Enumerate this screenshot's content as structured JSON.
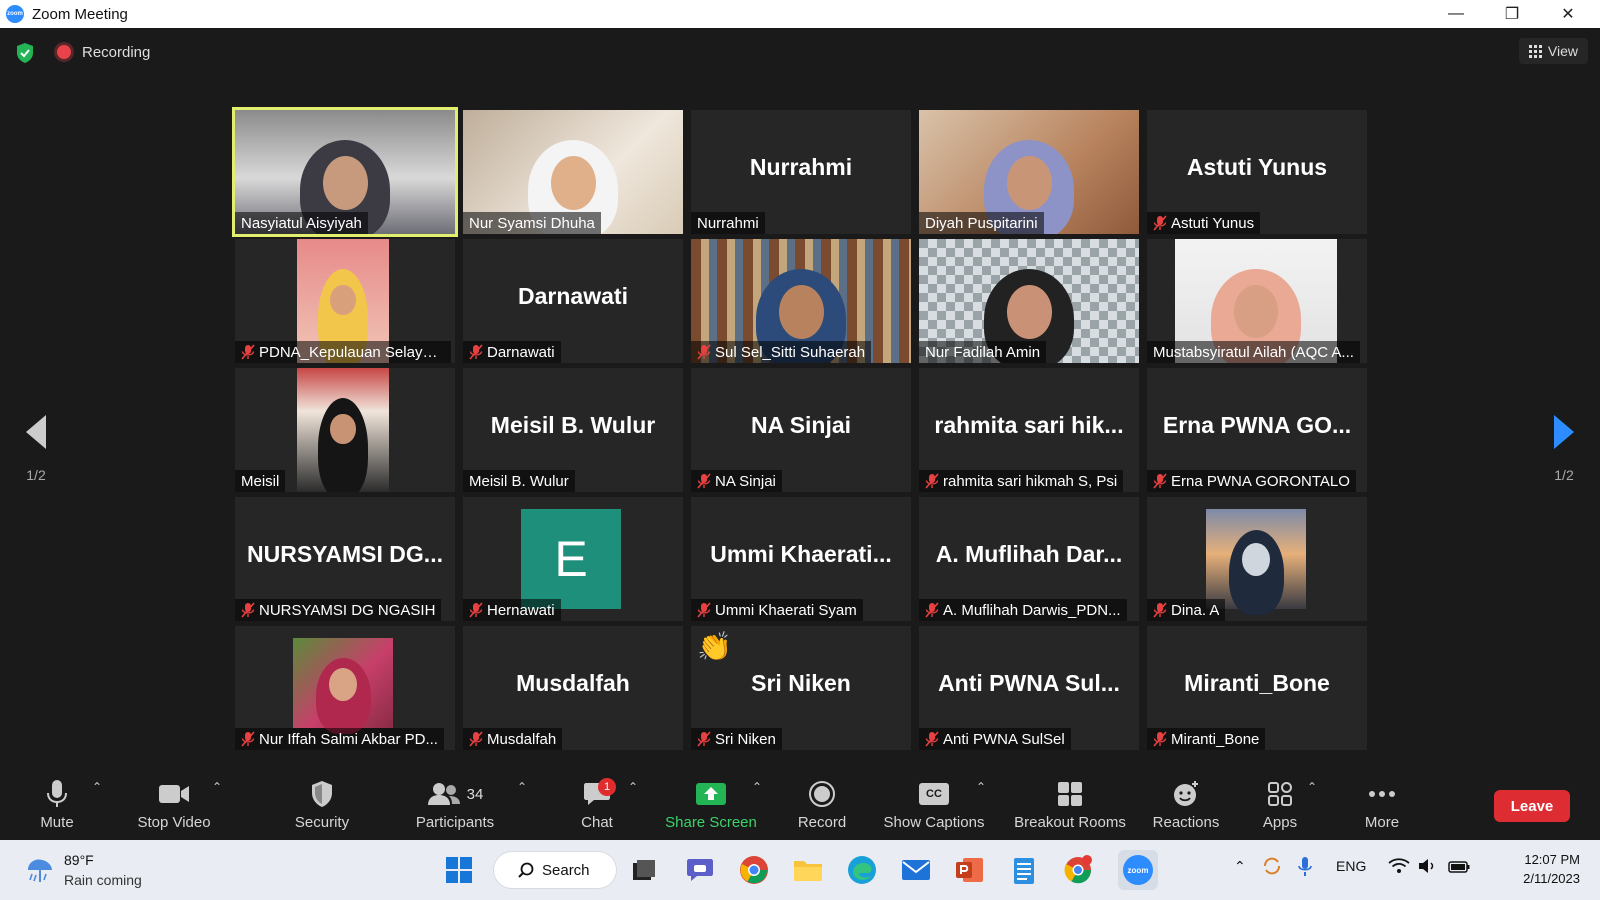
{
  "window": {
    "title": "Zoom Meeting",
    "logo_text": "zoom"
  },
  "topbar": {
    "recording_label": "Recording",
    "view_label": "View"
  },
  "grid": {
    "tiles": [
      {
        "name": "Nasyiatul Aisyiyah",
        "big": "",
        "muted": false,
        "active": true
      },
      {
        "name": "Nur Syamsi Dhuha",
        "big": "",
        "muted": false
      },
      {
        "name": "Nurrahmi",
        "big": "Nurrahmi",
        "muted": false
      },
      {
        "name": "Diyah Puspitarini",
        "big": "",
        "muted": false
      },
      {
        "name": "Astuti Yunus",
        "big": "Astuti Yunus",
        "muted": true
      },
      {
        "name": "PDNA_Kepulauan Selayar...",
        "big": "",
        "muted": true
      },
      {
        "name": "Darnawati",
        "big": "Darnawati",
        "muted": true
      },
      {
        "name": "Sul Sel_Sitti Suhaerah",
        "big": "",
        "muted": true
      },
      {
        "name": "Nur Fadilah Amin",
        "big": "",
        "muted": false
      },
      {
        "name": "Mustabsyiratul Ailah (AQC A...",
        "big": "",
        "muted": false
      },
      {
        "name": "Meisil",
        "big": "",
        "muted": false
      },
      {
        "name": "Meisil B. Wulur",
        "big": "Meisil B. Wulur",
        "muted": false
      },
      {
        "name": "NA Sinjai",
        "big": "NA Sinjai",
        "muted": true
      },
      {
        "name": "rahmita sari hikmah S, Psi",
        "big": "rahmita sari hik...",
        "muted": true
      },
      {
        "name": "Erna PWNA GORONTALO",
        "big": "Erna PWNA GO...",
        "muted": true
      },
      {
        "name": "NURSYAMSI DG NGASIH",
        "big": "NURSYAMSI DG...",
        "muted": true
      },
      {
        "name": "Hernawati",
        "big": "",
        "muted": true,
        "avatar_letter": "E"
      },
      {
        "name": "Ummi Khaerati Syam",
        "big": "Ummi Khaerati...",
        "muted": true
      },
      {
        "name": "A. Muflihah Darwis_PDN...",
        "big": "A. Muflihah Dar...",
        "muted": true
      },
      {
        "name": "Dina. A",
        "big": "",
        "muted": true
      },
      {
        "name": "Nur Iffah Salmi Akbar PD...",
        "big": "",
        "muted": true
      },
      {
        "name": "Musdalfah",
        "big": "Musdalfah",
        "muted": true
      },
      {
        "name": "Sri Niken",
        "big": "Sri Niken",
        "muted": true,
        "reaction": "👏"
      },
      {
        "name": "Anti PWNA SulSel",
        "big": "Anti PWNA Sul...",
        "muted": true
      },
      {
        "name": "Miranti_Bone",
        "big": "Miranti_Bone",
        "muted": true
      }
    ],
    "page_left": "1/2",
    "page_right": "1/2"
  },
  "toolbar": {
    "mute": "Mute",
    "stop_video": "Stop Video",
    "security": "Security",
    "participants": "Participants",
    "participants_count": "34",
    "chat": "Chat",
    "chat_badge": "1",
    "share_screen": "Share Screen",
    "record": "Record",
    "show_captions": "Show Captions",
    "captions_icon_text": "CC",
    "breakout_rooms": "Breakout Rooms",
    "reactions": "Reactions",
    "apps": "Apps",
    "more": "More",
    "leave": "Leave"
  },
  "taskbar": {
    "weather_temp": "89°F",
    "weather_desc": "Rain coming",
    "search_label": "Search",
    "lang": "ENG",
    "time": "12:07 PM",
    "date": "2/11/2023",
    "zoom_tk_text": "zoom"
  },
  "colors": {
    "active_speaker": "#e2ee6d",
    "leave": "#dd2d32",
    "share_green": "#3ad36a",
    "accent_blue": "#2d8cff"
  }
}
